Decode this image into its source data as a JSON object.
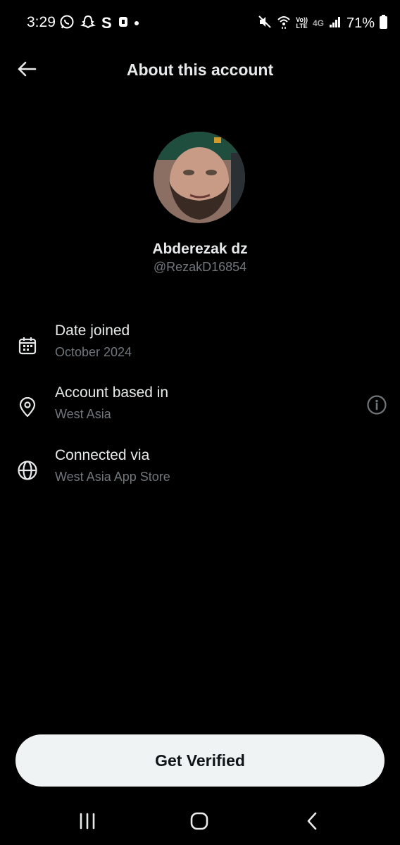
{
  "status_bar": {
    "time": "3:29",
    "carrier_label": "S",
    "volte_top": "Vo))",
    "volte_bottom": "LTE",
    "network": "4G",
    "battery": "71%",
    "icons": [
      "whatsapp-icon",
      "snapchat-icon",
      "s-app-icon",
      "notification-icon",
      "dot-icon",
      "mute-icon",
      "wifi-icon",
      "volte-icon",
      "network-4g-icon",
      "signal-icon",
      "battery-icon"
    ]
  },
  "header": {
    "title": "About this account",
    "back_icon": "arrow-left-icon"
  },
  "profile": {
    "display_name": "Abderezak dz",
    "handle": "@RezakD16854"
  },
  "info_rows": [
    {
      "icon": "calendar-icon",
      "title": "Date joined",
      "value": "October 2024"
    },
    {
      "icon": "location-pin-icon",
      "title": "Account based in",
      "value": "West Asia",
      "action_icon": "info-icon"
    },
    {
      "icon": "globe-icon",
      "title": "Connected via",
      "value": "West Asia App Store"
    }
  ],
  "cta": {
    "label": "Get Verified"
  },
  "nav_bar": {
    "icons": [
      "recents-icon",
      "home-icon",
      "back-icon"
    ]
  },
  "colors": {
    "background": "#000000",
    "primary_text": "#e7e9ea",
    "secondary_text": "#71767b",
    "button_bg": "#eff3f4",
    "button_text": "#0f1419"
  }
}
